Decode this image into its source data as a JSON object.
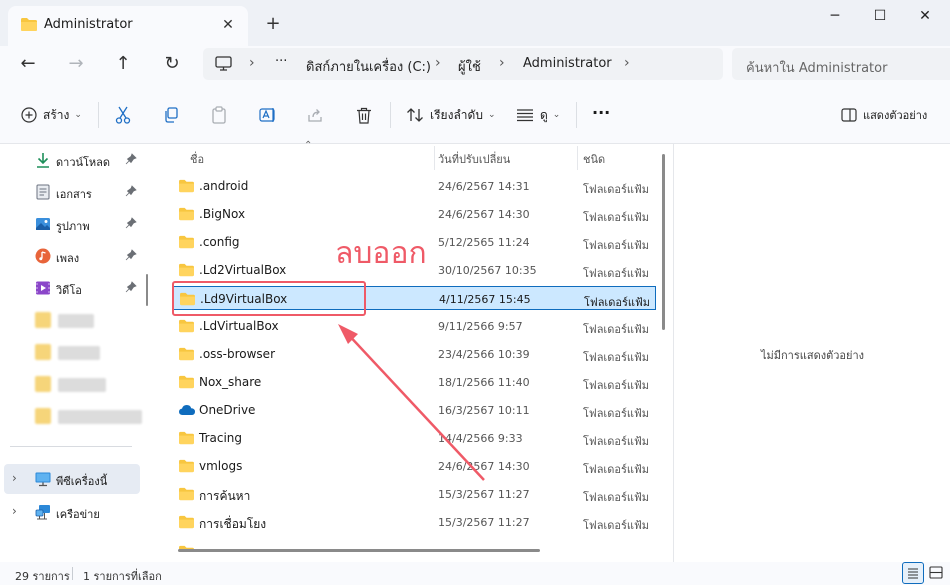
{
  "window": {
    "tab_title": "Administrator",
    "tab_close": "✕",
    "new_tab": "+",
    "minimize": "─",
    "maximize": "☐",
    "close": "✕"
  },
  "nav": {
    "back": "←",
    "forward": "→",
    "up": "↑",
    "refresh": "↻",
    "more": "···",
    "breadcrumb": [
      "ดิสก์ภายในเครื่อง (C:)",
      "ผู้ใช้",
      "Administrator"
    ],
    "separator": "›",
    "search_placeholder": "ค้นหาใน Administrator"
  },
  "toolbar": {
    "new_label": "สร้าง",
    "sort_label": "เรียงลำดับ",
    "view_label": "ดู",
    "more_label": "···",
    "details_label": "แสดงตัวอย่าง",
    "caret": "⌄"
  },
  "sidebar": {
    "pinned": [
      {
        "label": "ดาวน์โหลด",
        "icon": "download-icon"
      },
      {
        "label": "เอกสาร",
        "icon": "document-icon"
      },
      {
        "label": "รูปภาพ",
        "icon": "pictures-icon"
      },
      {
        "label": "เพลง",
        "icon": "music-icon"
      },
      {
        "label": "วิดีโอ",
        "icon": "video-icon"
      }
    ],
    "this_pc": "พีซีเครื่องนี้",
    "network": "เครือข่าย",
    "chevron": "›"
  },
  "columns": {
    "name": "ชื่อ",
    "modified": "วันที่ปรับเปลี่ยน",
    "type": "ชนิด",
    "sort_indicator": "⌃"
  },
  "files": [
    {
      "name": ".android",
      "date": "24/6/2567 14:31",
      "type": "โฟลเดอร์แฟ้ม",
      "icon": "folder-icon"
    },
    {
      "name": ".BigNox",
      "date": "24/6/2567 14:30",
      "type": "โฟลเดอร์แฟ้ม",
      "icon": "folder-icon"
    },
    {
      "name": ".config",
      "date": "5/12/2565 11:24",
      "type": "โฟลเดอร์แฟ้ม",
      "icon": "folder-icon"
    },
    {
      "name": ".Ld2VirtualBox",
      "date": "30/10/2567 10:35",
      "type": "โฟลเดอร์แฟ้ม",
      "icon": "folder-icon"
    },
    {
      "name": ".Ld9VirtualBox",
      "date": "4/11/2567 15:45",
      "type": "โฟลเดอร์แฟ้ม",
      "icon": "folder-icon",
      "selected": true
    },
    {
      "name": ".LdVirtualBox",
      "date": "9/11/2566 9:57",
      "type": "โฟลเดอร์แฟ้ม",
      "icon": "folder-icon"
    },
    {
      "name": ".oss-browser",
      "date": "23/4/2566 10:39",
      "type": "โฟลเดอร์แฟ้ม",
      "icon": "folder-icon"
    },
    {
      "name": "Nox_share",
      "date": "18/1/2566 11:40",
      "type": "โฟลเดอร์แฟ้ม",
      "icon": "folder-icon"
    },
    {
      "name": "OneDrive",
      "date": "16/3/2567 10:11",
      "type": "โฟลเดอร์แฟ้ม",
      "icon": "cloud-icon"
    },
    {
      "name": "Tracing",
      "date": "14/4/2566 9:33",
      "type": "โฟลเดอร์แฟ้ม",
      "icon": "folder-icon"
    },
    {
      "name": "vmlogs",
      "date": "24/6/2567 14:30",
      "type": "โฟลเดอร์แฟ้ม",
      "icon": "folder-icon"
    },
    {
      "name": "การค้นหา",
      "date": "15/3/2567 11:27",
      "type": "โฟลเดอร์แฟ้ม",
      "icon": "folder-icon"
    },
    {
      "name": "การเชื่อมโยง",
      "date": "15/3/2567 11:27",
      "type": "โฟลเดอร์แฟ้ม",
      "icon": "folder-icon"
    }
  ],
  "preview": {
    "message": "ไม่มีการแสดงตัวอย่าง"
  },
  "status": {
    "item_count": "29 รายการ",
    "selected_count": "1 รายการที่เลือก"
  },
  "annotation": {
    "text": "ลบออก",
    "color": "#ef5a67"
  },
  "colors": {
    "accent": "#0f6cbd",
    "selection": "#cce8ff",
    "folder": "#f8c640"
  }
}
